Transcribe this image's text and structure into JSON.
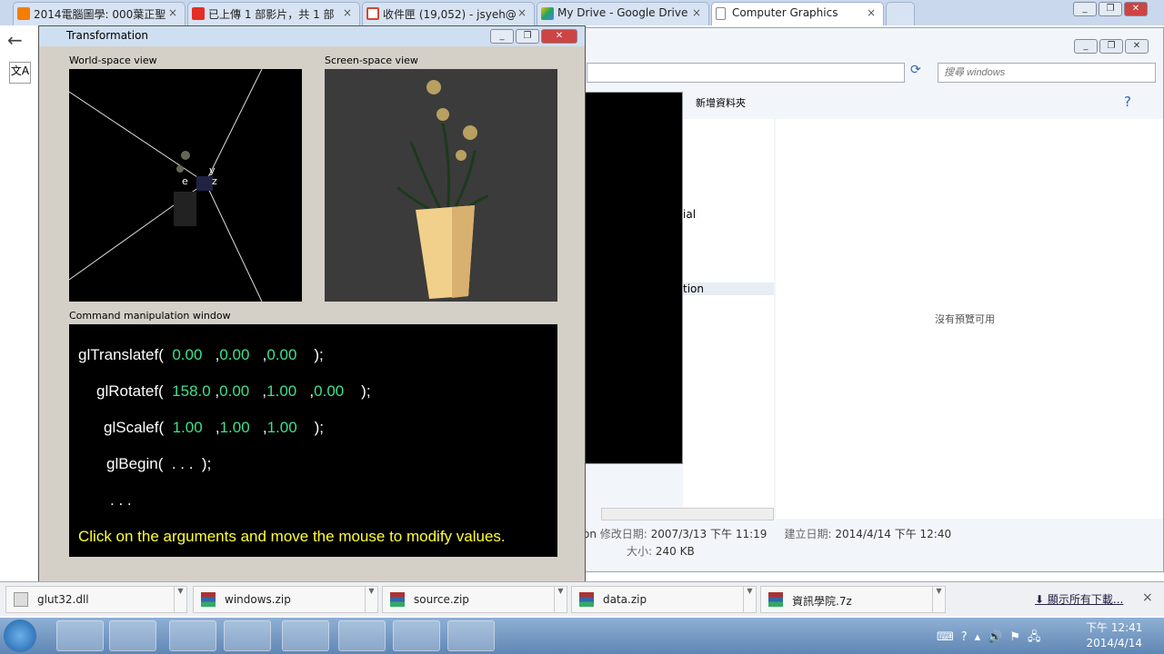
{
  "browser": {
    "tabs": [
      {
        "label": "2014電腦圖學: 000葉正聖",
        "color": "#f57d00"
      },
      {
        "label": "已上傳 1 部影片，共 1 部",
        "color": "#e52d27"
      },
      {
        "label": "收件匣 (19,052) - jsyeh@",
        "color": "#d14836"
      },
      {
        "label": "My Drive - Google Drive",
        "color": "#1fa463"
      },
      {
        "label": "Computer Graphics",
        "color": "#ffffff"
      }
    ]
  },
  "explorer": {
    "search_placeholder": "搜尋 windows",
    "new_folder": "新增資料夾",
    "no_preview": "沒有預覽可用",
    "frag1": "ial",
    "frag2": "tion",
    "frag3": "on",
    "modified_label": "修改日期:",
    "modified": "2007/3/13 下午 11:19",
    "created_label": "建立日期:",
    "created": "2014/4/14 下午 12:40",
    "size_label": "大小:",
    "size": "240 KB"
  },
  "window": {
    "title": "Transformation",
    "world_label": "World-space view",
    "screen_label": "Screen-space view",
    "command_label": "Command manipulation window",
    "translate": {
      "fn": "glTranslatef(",
      "args": [
        "0.00",
        "0.00",
        "0.00"
      ]
    },
    "rotate": {
      "fn": "glRotatef(",
      "args": [
        "158.0",
        "0.00",
        "1.00",
        "0.00"
      ]
    },
    "scale": {
      "fn": "glScalef(",
      "args": [
        "1.00",
        "1.00",
        "1.00"
      ]
    },
    "begin": {
      "fn": "glBegin(",
      "args": ". . ."
    },
    "ellipsis": ". . .",
    "end": ");",
    "hint": "Click on the arguments and move the mouse to modify values.",
    "axis_labels": [
      "e",
      "y",
      "z"
    ]
  },
  "downloads": {
    "items": [
      "glut32.dll",
      "windows.zip",
      "source.zip",
      "data.zip",
      "資訊學院.7z"
    ],
    "show_all": "顯示所有下載..."
  },
  "taskbar": {
    "time": "下午 12:41",
    "date": "2014/4/14"
  }
}
